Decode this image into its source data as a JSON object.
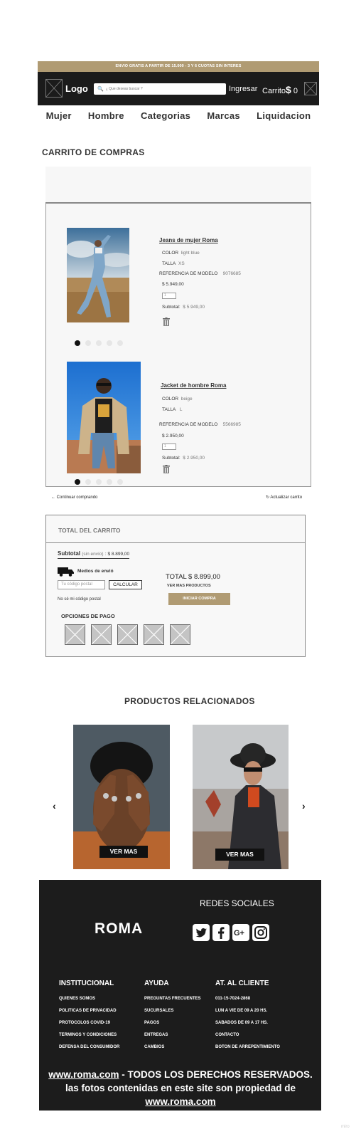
{
  "promo": "ENVIO GRATIS A PARTIR DE 15.000 - 3 Y 6 CUOTAS SIN INTERES",
  "header": {
    "logo": "Logo",
    "search_placeholder": "¿ Que deseas buscar ?",
    "login": "Ingresar",
    "cart_label": "Carrito",
    "cart_currency": "$",
    "cart_total": "0"
  },
  "nav": [
    "Mujer",
    "Hombre",
    "Categorias",
    "Marcas",
    "Liquidacion"
  ],
  "cart": {
    "title": "CARRITO DE COMPRAS",
    "items": [
      {
        "name": "Jeans de mujer Roma",
        "color_label": "COLOR",
        "color": "light blue",
        "size_label": "TALLA",
        "size": "XS",
        "ref_label": "REFERENCIA DE MODELO",
        "ref": "9076685",
        "price": "$ 5.949,00",
        "qty": "1",
        "subtotal_label": "Subtotal:",
        "subtotal": "$ 5.949,00"
      },
      {
        "name": "Jacket de hombre Roma",
        "color_label": "COLOR",
        "color": "beige",
        "size_label": "TALLA",
        "size": "L",
        "ref_label": "REFERENCIA DE MODELO",
        "ref": "5566985",
        "price": "$ 2.950,00",
        "qty": "1",
        "subtotal_label": "Subtotal:",
        "subtotal": "$ 2.950,00"
      }
    ],
    "continue": "Continuar comprando",
    "update": "Actualizar carrito"
  },
  "totals": {
    "title": "TOTAL DEL CARRITO",
    "subtotal_label": "Subtotal",
    "subtotal_note": "(sin envío)",
    "subtotal_value": ": $ 8.899,00",
    "shipping_label": "Medios de envió",
    "postal_placeholder": "Tu código postal",
    "calculate": "CALCULAR",
    "no_postal": "No sé mi código postal",
    "total": "TOTAL  $ 8.899,00",
    "see_more": "VER MAS PRODUCTOS",
    "checkout": "INICIAR COMPRA",
    "payment_title": "OPCIONES DE PAGO"
  },
  "related": {
    "title": "PRODUCTOS RELACIONADOS",
    "items": [
      {
        "cta": "VER MAS"
      },
      {
        "cta": "VER MAS"
      }
    ]
  },
  "footer": {
    "brand": "ROMA",
    "social_title": "REDES SOCIALES",
    "social_icons": [
      "twitter-icon",
      "facebook-icon",
      "google-plus-icon",
      "instagram-icon"
    ],
    "columns": [
      {
        "title": "INSTITUCIONAL",
        "items": [
          "QUIENES SOMOS",
          "POLITICAS DE PRIVACIDAD",
          "PROTOCOLOS COVID-19",
          "TERMINOS Y CONDICIONES",
          "DEFENSA DEL CONSUMIDOR"
        ]
      },
      {
        "title": "AYUDA",
        "items": [
          "PREGUNTAS FRECUENTES",
          "SUCURSALES",
          "PAGOS",
          "ENTREGAS",
          "CAMBIOS"
        ]
      },
      {
        "title": "AT. AL CLIENTE",
        "items": [
          "011-15-7024-2868",
          "LUN A VIE DE 09 A 20 HS.",
          "SABADOS DE 09 A 17 HS.",
          "CONTACTO",
          "BOTON DE ARREPENTIMIENTO"
        ]
      }
    ],
    "copyright_link": "www.roma.com",
    "copyright_text": " - TODOS LOS DERECHOS RESERVADOS. las fotos contenidas en este site son propiedad de ",
    "copyright_link2": "www.roma.com"
  },
  "watermark": "miro",
  "colors": {
    "accent": "#b09b73",
    "dark": "#1b1b1b"
  }
}
